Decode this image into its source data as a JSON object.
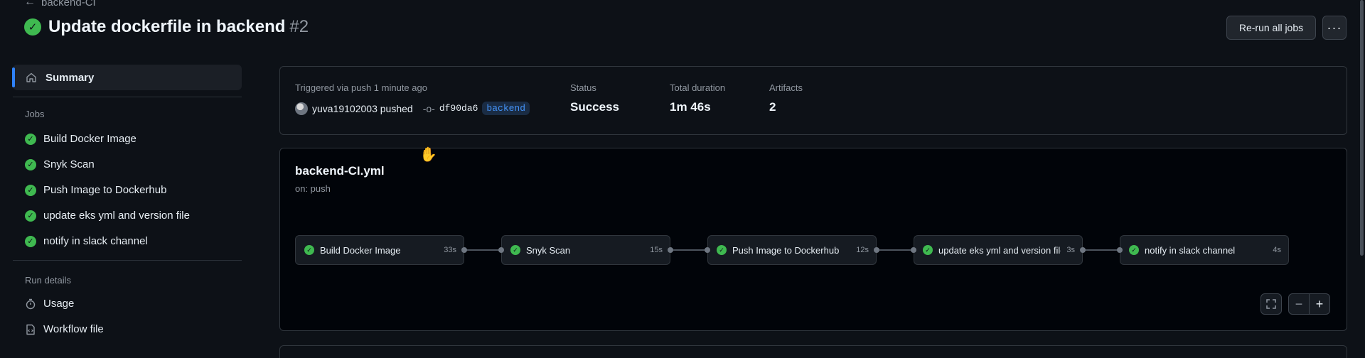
{
  "header": {
    "back_label": "backend-CI",
    "title": "Update dockerfile in backend",
    "run_number": "#2",
    "rerun_label": "Re-run all jobs",
    "more_label": "···"
  },
  "sidebar": {
    "summary_label": "Summary",
    "jobs_heading": "Jobs",
    "jobs": [
      {
        "label": "Build Docker Image"
      },
      {
        "label": "Snyk Scan"
      },
      {
        "label": "Push Image to Dockerhub"
      },
      {
        "label": "update eks yml and version file"
      },
      {
        "label": "notify in slack channel"
      }
    ],
    "run_details_heading": "Run details",
    "usage_label": "Usage",
    "workflow_file_label": "Workflow file"
  },
  "summary": {
    "trigger_text": "Triggered via push 1 minute ago",
    "actor": "yuva19102003 pushed",
    "commit": "df90da6",
    "branch": "backend",
    "status_label": "Status",
    "status_value": "Success",
    "duration_label": "Total duration",
    "duration_value": "1m 46s",
    "artifacts_label": "Artifacts",
    "artifacts_value": "2"
  },
  "workflow": {
    "file": "backend-CI.yml",
    "trigger": "on: push",
    "jobs": [
      {
        "name": "Build Docker Image",
        "duration": "33s"
      },
      {
        "name": "Snyk Scan",
        "duration": "15s"
      },
      {
        "name": "Push Image to Dockerhub",
        "duration": "12s"
      },
      {
        "name": "update eks yml and version file",
        "duration": "3s"
      },
      {
        "name": "notify in slack channel",
        "duration": "4s"
      }
    ],
    "zoom_out_label": "−",
    "zoom_in_label": "+"
  },
  "colors": {
    "success": "#3fb950",
    "accent": "#2f81f7",
    "background": "#0d1117"
  }
}
